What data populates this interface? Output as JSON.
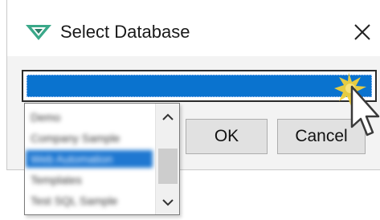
{
  "dialog": {
    "title": "Select Database",
    "icon": "app-logo-icon",
    "close_icon": "close-icon"
  },
  "database_combo": {
    "selected_value": ""
  },
  "dropdown": {
    "items": [
      {
        "label": "Demo",
        "selected": false
      },
      {
        "label": "Company Sample",
        "selected": false
      },
      {
        "label": "Web Automation",
        "selected": true
      },
      {
        "label": "Templates",
        "selected": false
      },
      {
        "label": "Test SQL Sample",
        "selected": false
      }
    ],
    "scroll_up_icon": "chevron-up-icon",
    "scroll_down_icon": "chevron-down-icon"
  },
  "buttons": {
    "ok_label": "OK",
    "cancel_label": "Cancel"
  },
  "colors": {
    "selection_blue": "#0a73cf",
    "click_highlight": "#f2d13a"
  }
}
